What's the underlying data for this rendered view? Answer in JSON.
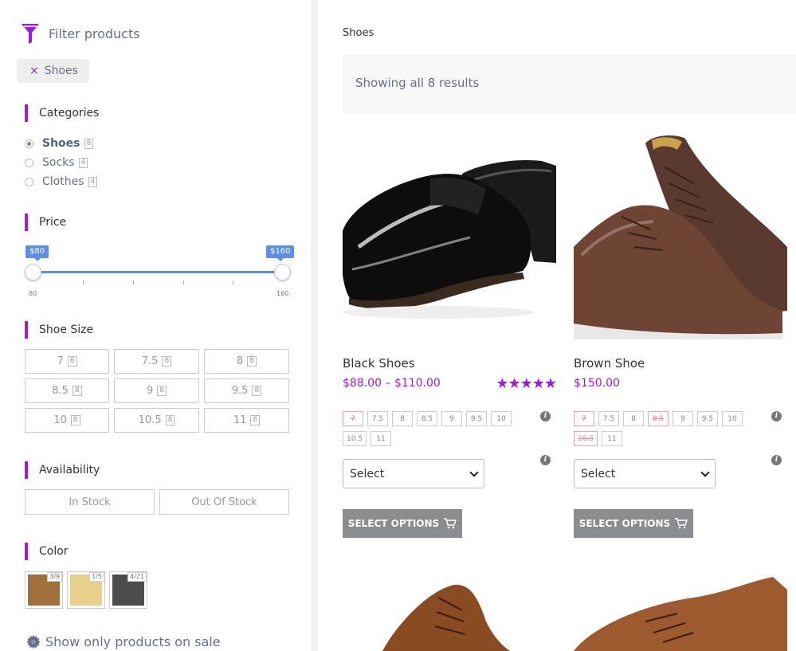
{
  "sidebar": {
    "filter_title": "Filter products",
    "active_filter": {
      "remove_symbol": "×",
      "label": "Shoes"
    },
    "categories": {
      "heading": "Categories",
      "items": [
        {
          "label": "Shoes",
          "count": "8",
          "selected": true
        },
        {
          "label": "Socks",
          "count": "4",
          "selected": false
        },
        {
          "label": "Clothes",
          "count": "4",
          "selected": false
        }
      ]
    },
    "price": {
      "heading": "Price",
      "min_badge": "$80",
      "max_badge": "$160",
      "range_min_label": "80",
      "range_max_label": "160"
    },
    "shoe_size": {
      "heading": "Shoe Size",
      "options": [
        {
          "label": "7",
          "count": "8"
        },
        {
          "label": "7.5",
          "count": "8"
        },
        {
          "label": "8",
          "count": "8"
        },
        {
          "label": "8.5",
          "count": "8"
        },
        {
          "label": "9",
          "count": "8"
        },
        {
          "label": "9.5",
          "count": "8"
        },
        {
          "label": "10",
          "count": "8"
        },
        {
          "label": "10.5",
          "count": "8"
        },
        {
          "label": "11",
          "count": "8"
        }
      ]
    },
    "availability": {
      "heading": "Availability",
      "options": [
        "In Stock",
        "Out Of Stock"
      ]
    },
    "color": {
      "heading": "Color",
      "swatches": [
        {
          "color": "#a0703a",
          "count": "3/9"
        },
        {
          "color": "#e8d08a",
          "count": "1/5"
        },
        {
          "color": "#4c4c4c",
          "count": "4/21"
        }
      ]
    },
    "sale_toggle": "Show only products on sale"
  },
  "main": {
    "breadcrumb": "Shoes",
    "result_count": "Showing all 8 results",
    "products": [
      {
        "title": "Black Shoes",
        "price": "$88.00 – $110.00",
        "rating_stars": "★★★★★",
        "sizes": [
          {
            "label": "7",
            "oos": true
          },
          {
            "label": "7.5",
            "oos": false
          },
          {
            "label": "8",
            "oos": false
          },
          {
            "label": "8.5",
            "oos": false
          },
          {
            "label": "9",
            "oos": false
          },
          {
            "label": "9.5",
            "oos": false
          },
          {
            "label": "10",
            "oos": false
          },
          {
            "label": "10.5",
            "oos": false
          },
          {
            "label": "11",
            "oos": false
          }
        ],
        "select_value": "Select",
        "button_label": "SELECT OPTIONS"
      },
      {
        "title": "Brown Shoe",
        "price": "$150.00",
        "rating_stars": "",
        "sizes": [
          {
            "label": "7",
            "oos": true
          },
          {
            "label": "7.5",
            "oos": false
          },
          {
            "label": "8",
            "oos": false
          },
          {
            "label": "8.5",
            "oos": true
          },
          {
            "label": "9",
            "oos": false
          },
          {
            "label": "9.5",
            "oos": false
          },
          {
            "label": "10",
            "oos": false
          },
          {
            "label": "10.5",
            "oos": true
          },
          {
            "label": "11",
            "oos": false
          }
        ],
        "select_value": "Select",
        "button_label": "SELECT OPTIONS"
      }
    ]
  },
  "colors": {
    "accent": "#9b1ce0",
    "slider": "#5b8fe8",
    "button": "#8a8c8f"
  }
}
